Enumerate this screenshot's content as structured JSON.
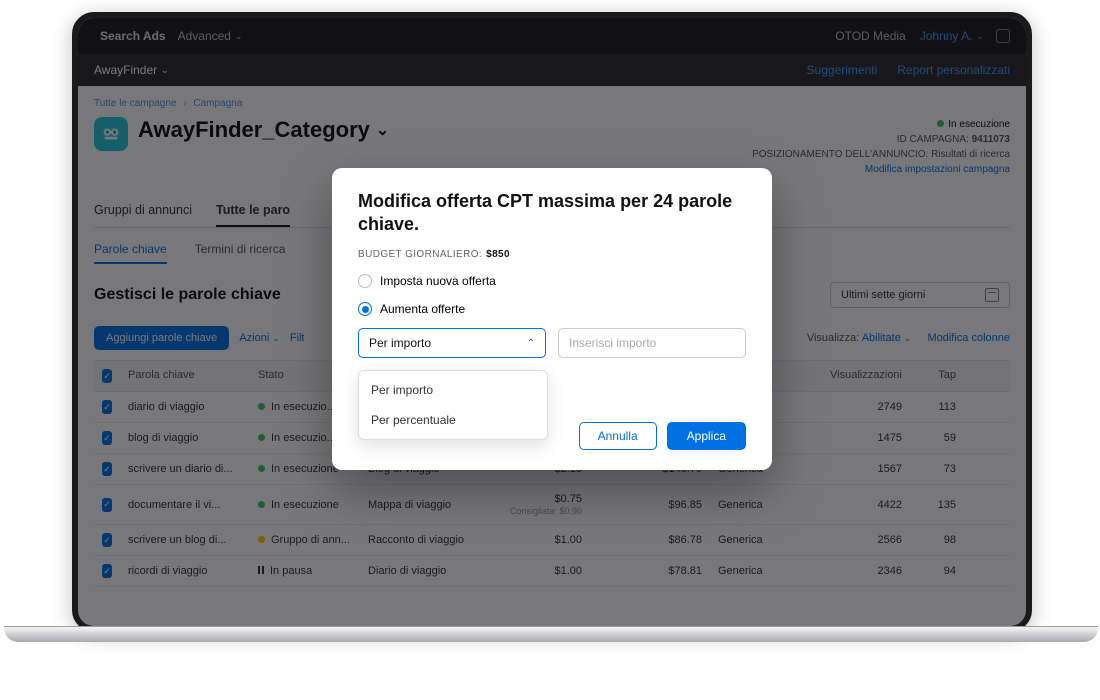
{
  "topbar": {
    "brand": "Search Ads",
    "advanced": "Advanced",
    "org": "OTOD Media",
    "user": "Johnny A."
  },
  "subbar": {
    "app": "AwayFinder",
    "suggestions": "Suggerimenti",
    "reports": "Report personalizzati"
  },
  "breadcrumb": {
    "all": "Tutte le campagne",
    "current": "Campagna"
  },
  "campaign": {
    "title": "AwayFinder_Category",
    "status": "In esecuzione",
    "id_label": "ID CAMPAGNA:",
    "id": "9411073",
    "placement_label": "POSIZIONAMENTO DELL'ANNUNCIO:",
    "placement": "Risultati di ricerca",
    "edit_link": "Modifica impostazioni campagna"
  },
  "tabs1": {
    "t0": "Gruppi di annunci",
    "t1": "Tutte le paro"
  },
  "tabs2": {
    "t0": "Parole chiave",
    "t1": "Termini di ricerca"
  },
  "section": {
    "title": "Gestisci le parole chiave",
    "date_range": "Ultimi sette giorni"
  },
  "toolbar": {
    "add": "Aggiungi parole chiave",
    "actions": "Azioni",
    "filter": "Filt",
    "view_label": "Visualizza:",
    "view_value": "Abilitate",
    "cols": "Modifica colonne"
  },
  "table": {
    "headers": {
      "kw": "Parola chiave",
      "state": "Stato",
      "bid": "",
      "spend": "",
      "match": "",
      "imp": "Visualizzazioni",
      "tap": "Tap"
    },
    "rows": [
      {
        "kw": "diario di viaggio",
        "state": "In esecuzio...",
        "dot": "green",
        "grp": "",
        "bid": "",
        "spend": "",
        "match": "",
        "imp": "2749",
        "tap": "113"
      },
      {
        "kw": "blog di viaggio",
        "state": "In esecuzio...",
        "dot": "green",
        "grp": "",
        "bid": "",
        "spend": "",
        "match": "",
        "imp": "1475",
        "tap": "59"
      },
      {
        "kw": "scrivere un diario di...",
        "state": "In esecuzione",
        "dot": "green",
        "grp": "Blog di viaggio",
        "bid": "$2.15",
        "spend": "$146.70",
        "match": "Generica",
        "imp": "1567",
        "tap": "73"
      },
      {
        "kw": "documentare il vi...",
        "state": "In esecuzione",
        "dot": "green",
        "grp": "Mappa di viaggio",
        "bid": "$0.75",
        "sugg": "Consigliata: $0.90",
        "spend": "$96.85",
        "match": "Generica",
        "imp": "4422",
        "tap": "135"
      },
      {
        "kw": "scrivere un blog di...",
        "state": "Gruppo di ann...",
        "dot": "yellow",
        "grp": "Racconto di viaggio",
        "bid": "$1.00",
        "spend": "$86.78",
        "match": "Generica",
        "imp": "2566",
        "tap": "98"
      },
      {
        "kw": "ricordi di viaggio",
        "state": "In pausa",
        "dot": "pause",
        "grp": "Diario di viaggio",
        "bid": "$1.00",
        "spend": "$78.81",
        "match": "Generica",
        "imp": "2346",
        "tap": "94"
      }
    ]
  },
  "modal": {
    "title": "Modifica offerta CPT massima per 24 parole chiave.",
    "budget_label": "BUDGET GIORNALIERO:",
    "budget_value": "$850",
    "radio1": "Imposta nuova offerta",
    "radio2": "Aumenta offerte",
    "select_value": "Per importo",
    "amount_placeholder": "Inserisci importo",
    "options": {
      "o0": "Per importo",
      "o1": "Per percentuale"
    },
    "cancel": "Annulla",
    "apply": "Applica"
  }
}
